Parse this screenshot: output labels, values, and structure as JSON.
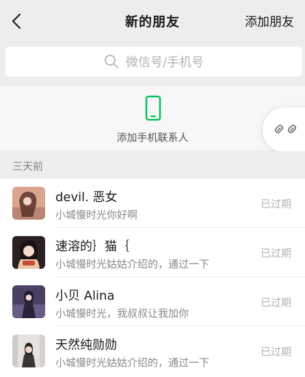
{
  "header": {
    "title": "新的朋友",
    "add_friends_label": "添加朋友"
  },
  "search": {
    "placeholder": "微信号/手机号"
  },
  "contacts_entry": {
    "label": "添加手机联系人"
  },
  "section": {
    "label": "三天前"
  },
  "requests": [
    {
      "name": "devil. 恶女",
      "message": "小城慢时光你好啊",
      "status": "已过期"
    },
    {
      "name": "速溶的｝猫｛",
      "message": "小城慢时光姑姑介绍的，通过一下",
      "status": "已过期"
    },
    {
      "name": "小贝 Alina",
      "message": "小城慢时光，我叔叔让我加你",
      "status": "已过期"
    },
    {
      "name": "天然纯勋勋",
      "message": "小城慢时光姑姑介绍的，通过一下",
      "status": "已过期"
    }
  ],
  "colors": {
    "accent_green": "#07c160",
    "background": "#ededed"
  }
}
